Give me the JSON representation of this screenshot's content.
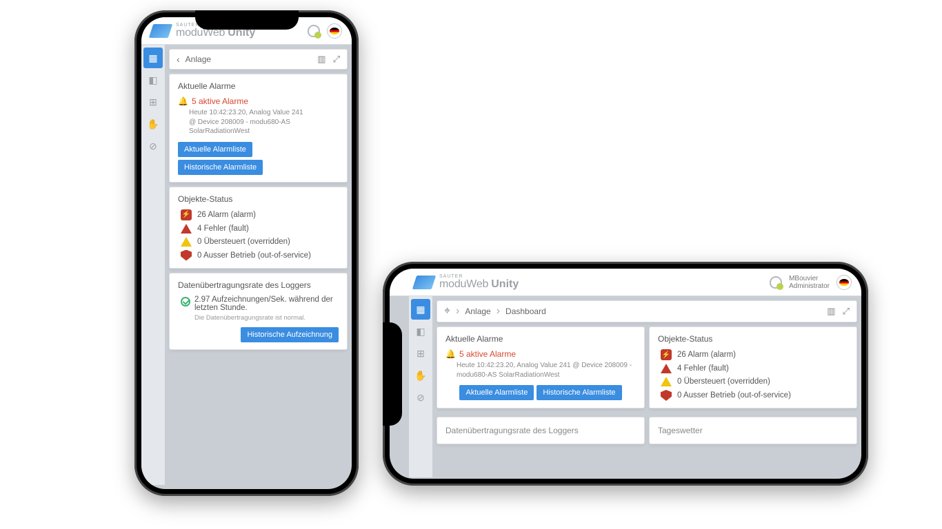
{
  "brand": {
    "sup": "SAUTER",
    "prefix": "moduWeb",
    "name": "Unity"
  },
  "user": {
    "name": "MBouvier",
    "role": "Administrator"
  },
  "breadcrumb": {
    "anlage": "Anlage",
    "dashboard": "Dashboard"
  },
  "cards": {
    "alarms": {
      "title": "Aktuelle Alarme",
      "headline": "5 aktive Alarme",
      "detail_l1": "Heute 10:42:23.20, Analog Value 241",
      "detail_l2": "@ Device 208009 - modu680-AS",
      "detail_l3": "SolarRadiationWest",
      "detail_h": "Heute 10:42:23.20, Analog Value 241 @ Device 208009 - modu680-AS SolarRadiationWest",
      "btn_current": "Aktuelle Alarmliste",
      "btn_history": "Historische Alarmliste"
    },
    "status": {
      "title": "Objekte-Status",
      "alarm": "26 Alarm (alarm)",
      "fault": "4 Fehler (fault)",
      "override_p": "0 Übersteuert (overridden)",
      "override_h": "0 Übersteuert (overridden)",
      "oos": "0 Ausser Betrieb (out-of-service)"
    },
    "logger": {
      "title": "Datenübertragungsrate des Loggers",
      "rate": "2.97 Aufzeichnungen/Sek. während der letzten Stunde.",
      "note": "Die Datenübertragungsrate ist normal.",
      "btn": "Historische Aufzeichnung"
    },
    "weather": {
      "title": "Tageswetter"
    }
  }
}
